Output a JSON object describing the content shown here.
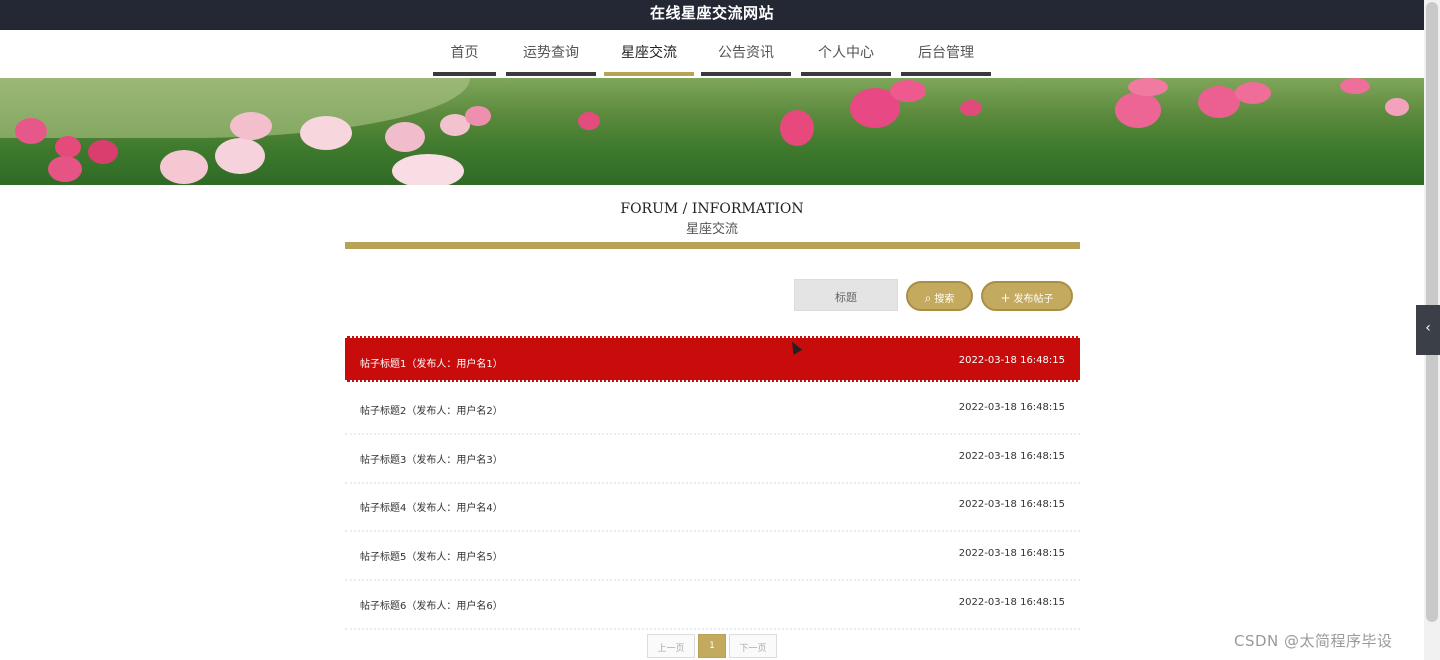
{
  "site": {
    "title": "在线星座交流网站"
  },
  "nav": {
    "items": [
      {
        "label": "首页"
      },
      {
        "label": "运势查询"
      },
      {
        "label": "星座交流"
      },
      {
        "label": "公告资讯"
      },
      {
        "label": "个人中心"
      },
      {
        "label": "后台管理"
      }
    ],
    "active_label": "星座交流"
  },
  "section": {
    "title": "FORUM / INFORMATION",
    "subtitle": "星座交流"
  },
  "toolbar": {
    "search_placeholder": "标题",
    "search_label": "搜索",
    "publish_label": "发布帖子",
    "search_icon": "magnifier-icon",
    "publish_icon": "plus-icon"
  },
  "posts": [
    {
      "title": "帖子标题1（发布人：用户名1）",
      "date": "2022-03-18 16:48:15"
    },
    {
      "title": "帖子标题2（发布人：用户名2）",
      "date": "2022-03-18 16:48:15"
    },
    {
      "title": "帖子标题3（发布人：用户名3）",
      "date": "2022-03-18 16:48:15"
    },
    {
      "title": "帖子标题4（发布人：用户名4）",
      "date": "2022-03-18 16:48:15"
    },
    {
      "title": "帖子标题5（发布人：用户名5）",
      "date": "2022-03-18 16:48:15"
    },
    {
      "title": "帖子标题6（发布人：用户名6）",
      "date": "2022-03-18 16:48:15"
    }
  ],
  "pagination": {
    "prev": "上一页",
    "current": "1",
    "next": "下一页"
  },
  "side_tab": {
    "icon": "chevron-left-icon",
    "glyph": "‹"
  },
  "watermark": "CSDN @太简程序毕设",
  "colors": {
    "accent": "#b8a255",
    "highlight": "#c80b0b",
    "topbar": "#232834"
  }
}
